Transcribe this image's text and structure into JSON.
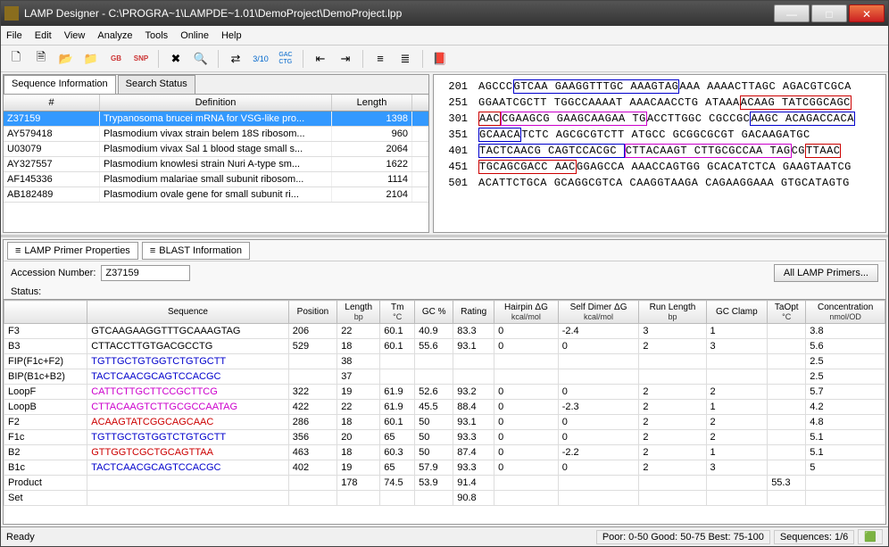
{
  "window": {
    "title": "LAMP Designer - C:\\PROGRA~1\\LAMPDE~1.01\\DemoProject\\DemoProject.lpp"
  },
  "menus": [
    "File",
    "Edit",
    "View",
    "Analyze",
    "Tools",
    "Online",
    "Help"
  ],
  "toolbar": {
    "icons": [
      "new-icon",
      "open-icon",
      "open-folder-icon",
      "folder-icon",
      "gb-icon",
      "snp-icon",
      "sep",
      "delete-icon",
      "find-icon",
      "sep",
      "threshold-icon",
      "ratio-icon",
      "gac-ctg-icon",
      "sep",
      "align-left-icon",
      "align-right-icon",
      "sep",
      "bars-icon",
      "bars2-icon",
      "sep",
      "book-icon"
    ],
    "labels": {
      "ratio-icon": "3/10",
      "gac-ctg-icon": "GAC\nCTG",
      "gb-icon": "GB",
      "snp-icon": "SNP"
    }
  },
  "seq_info": {
    "tabs": [
      "Sequence Information",
      "Search Status"
    ],
    "active_tab": 0,
    "headers": [
      "#",
      "Definition",
      "Length"
    ],
    "rows": [
      {
        "acc": "Z37159",
        "def": "Trypanosoma brucei mRNA for VSG-like pro...",
        "len": "1398",
        "selected": true
      },
      {
        "acc": "AY579418",
        "def": "Plasmodium vivax strain belem 18S ribosom...",
        "len": "960"
      },
      {
        "acc": "U03079",
        "def": "Plasmodium vivax Sal 1 blood stage small s...",
        "len": "2064"
      },
      {
        "acc": "AY327557",
        "def": "Plasmodium knowlesi strain Nuri A-type sm...",
        "len": "1622"
      },
      {
        "acc": "AF145336",
        "def": "Plasmodium malariae small subunit ribosom...",
        "len": "1114"
      },
      {
        "acc": "AB182489",
        "def": "Plasmodium ovale gene for small subunit ri...",
        "len": "2104"
      }
    ]
  },
  "seq_view": [
    {
      "pos": "201",
      "html": "AGCCC<span class='box-b'>GTCAA GAAGGTTTGC AAAGTAG</span>AAA AAAACTTAGC AGACGTCGCA"
    },
    {
      "pos": "251",
      "html": "GGAATCGCTT TGGCCAAAAT AAACAACCTG ATAAA<span class='box-r'>ACAAG TATCGGCAGC</span>"
    },
    {
      "pos": "301",
      "html": "<span class='box-r'>AAC</span><span class='box-m'>CGAAGCG GAAGCAAGAA TG</span>ACCTTGGC CGCCGC<span class='box-b'>AAGC ACAGACCACA</span>"
    },
    {
      "pos": "351",
      "html": "<span class='box-b'>GCAACA</span>TCTC AGCGCGTCTT ATGCC GCGGCGCGT GACAAGATGC"
    },
    {
      "pos": "401",
      "html": "<span class='box-b'>TACTCAACG CAGTCCACGC </span><span class='box-m'>CTTACAAGT CTTGCGCCAA TAG</span>CG<span class='box-r'>TTAAC</span>"
    },
    {
      "pos": "451",
      "html": "<span class='box-r'>TGCAGCGACC AAC</span>GGAGCCA AAACCAGTGG GCACATCTCA GAAGTAATCG"
    },
    {
      "pos": "501",
      "html": "ACATTCTGCA GCAGGCGTCA CAAGGTAAGA CAGAAGGAAA GTGCATAGTG"
    }
  ],
  "primer_panel": {
    "tabs": [
      "LAMP Primer Properties",
      "BLAST Information"
    ],
    "accession_label": "Accession Number:",
    "accession_value": "Z37159",
    "all_primers_btn": "All LAMP Primers...",
    "status_label": "Status:",
    "headers": [
      {
        "t": ""
      },
      {
        "t": "Sequence"
      },
      {
        "t": "Position"
      },
      {
        "t": "Length",
        "s": "bp"
      },
      {
        "t": "Tm",
        "s": "°C"
      },
      {
        "t": "GC %"
      },
      {
        "t": "Rating"
      },
      {
        "t": "Hairpin ΔG",
        "s": "kcal/mol"
      },
      {
        "t": "Self Dimer ΔG",
        "s": "kcal/mol"
      },
      {
        "t": "Run Length",
        "s": "bp"
      },
      {
        "t": "GC Clamp"
      },
      {
        "t": "TaOpt",
        "s": "°C"
      },
      {
        "t": "Concentration",
        "s": "nmol/OD"
      }
    ],
    "rows": [
      {
        "n": "F3",
        "cls": "",
        "seq": "GTCAAGAAGGTTTGCAAAGTAG",
        "pos": "206",
        "len": "22",
        "tm": "60.1",
        "gc": "40.9",
        "rat": "83.3",
        "hp": "0",
        "sd": "-2.4",
        "rl": "3",
        "gcc": "1",
        "ta": "",
        "conc": "3.8"
      },
      {
        "n": "B3",
        "cls": "",
        "seq": "CTTACCTTGTGACGCCTG",
        "pos": "529",
        "len": "18",
        "tm": "60.1",
        "gc": "55.6",
        "rat": "93.1",
        "hp": "0",
        "sd": "0",
        "rl": "2",
        "gcc": "3",
        "ta": "",
        "conc": "5.6"
      },
      {
        "n": "FIP(F1c+F2)",
        "cls": "seq-blue",
        "seq": "TGTTGCTGTGGTCTGTGCTT",
        "pos": "",
        "len": "38",
        "tm": "",
        "gc": "",
        "rat": "",
        "hp": "",
        "sd": "",
        "rl": "",
        "gcc": "",
        "ta": "",
        "conc": "2.5"
      },
      {
        "n": "BIP(B1c+B2)",
        "cls": "seq-blue",
        "seq": "TACTCAACGCAGTCCACGC",
        "pos": "",
        "len": "37",
        "tm": "",
        "gc": "",
        "rat": "",
        "hp": "",
        "sd": "",
        "rl": "",
        "gcc": "",
        "ta": "",
        "conc": "2.5"
      },
      {
        "n": "LoopF",
        "cls": "seq-mag",
        "seq": "CATTCTTGCTTCCGCTTCG",
        "pos": "322",
        "len": "19",
        "tm": "61.9",
        "gc": "52.6",
        "rat": "93.2",
        "hp": "0",
        "sd": "0",
        "rl": "2",
        "gcc": "2",
        "ta": "",
        "conc": "5.7"
      },
      {
        "n": "LoopB",
        "cls": "seq-mag",
        "seq": "CTTACAAGTCTTGCGCCAATAG",
        "pos": "422",
        "len": "22",
        "tm": "61.9",
        "gc": "45.5",
        "rat": "88.4",
        "hp": "0",
        "sd": "-2.3",
        "rl": "2",
        "gcc": "1",
        "ta": "",
        "conc": "4.2"
      },
      {
        "n": "F2",
        "cls": "seq-red",
        "seq": "ACAAGTATCGGCAGCAAC",
        "pos": "286",
        "len": "18",
        "tm": "60.1",
        "gc": "50",
        "rat": "93.1",
        "hp": "0",
        "sd": "0",
        "rl": "2",
        "gcc": "2",
        "ta": "",
        "conc": "4.8"
      },
      {
        "n": "F1c",
        "cls": "seq-blue",
        "seq": "TGTTGCTGTGGTCTGTGCTT",
        "pos": "356",
        "len": "20",
        "tm": "65",
        "gc": "50",
        "rat": "93.3",
        "hp": "0",
        "sd": "0",
        "rl": "2",
        "gcc": "2",
        "ta": "",
        "conc": "5.1"
      },
      {
        "n": "B2",
        "cls": "seq-red",
        "seq": "GTTGGTCGCTGCAGTTAA",
        "pos": "463",
        "len": "18",
        "tm": "60.3",
        "gc": "50",
        "rat": "87.4",
        "hp": "0",
        "sd": "-2.2",
        "rl": "2",
        "gcc": "1",
        "ta": "",
        "conc": "5.1"
      },
      {
        "n": "B1c",
        "cls": "seq-blue",
        "seq": "TACTCAACGCAGTCCACGC",
        "pos": "402",
        "len": "19",
        "tm": "65",
        "gc": "57.9",
        "rat": "93.3",
        "hp": "0",
        "sd": "0",
        "rl": "2",
        "gcc": "3",
        "ta": "",
        "conc": "5"
      },
      {
        "n": "Product",
        "cls": "",
        "seq": "",
        "pos": "",
        "len": "178",
        "tm": "74.5",
        "gc": "53.9",
        "rat": "91.4",
        "hp": "",
        "sd": "",
        "rl": "",
        "gcc": "",
        "ta": "55.3",
        "conc": ""
      },
      {
        "n": "Set",
        "cls": "",
        "seq": "",
        "pos": "",
        "len": "",
        "tm": "",
        "gc": "",
        "rat": "90.8",
        "hp": "",
        "sd": "",
        "rl": "",
        "gcc": "",
        "ta": "",
        "conc": ""
      }
    ]
  },
  "statusbar": {
    "ready": "Ready",
    "legend": "Poor: 0-50 Good: 50-75 Best: 75-100",
    "sequences": "Sequences: 1/6"
  }
}
